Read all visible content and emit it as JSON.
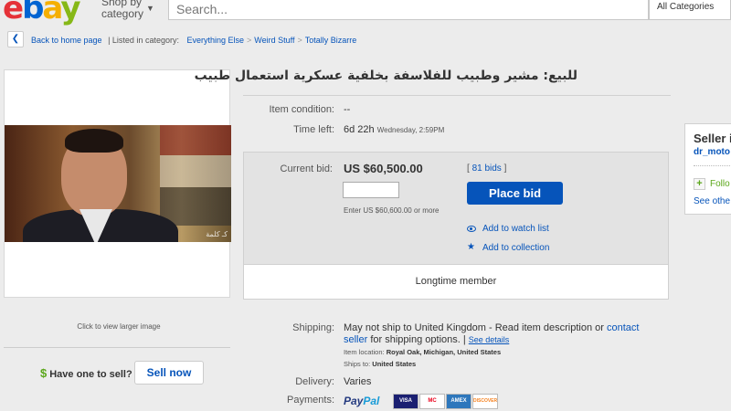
{
  "header": {
    "logo": {
      "e": "e",
      "b": "b",
      "a": "a",
      "y": "y"
    },
    "shop_by_category": "Shop by category",
    "search_placeholder": "Search...",
    "category_select": "All Categories"
  },
  "breadcrumb": {
    "back_label": "Back to home page",
    "listed_in": "| Listed in category:",
    "items": [
      "Everything Else",
      "Weird Stuff",
      "Totally Bizarre"
    ],
    "separator": ">"
  },
  "image_panel": {
    "watermark": "كـ كلمة",
    "view_larger": "Click to view larger image"
  },
  "sell": {
    "prompt": "Have one to sell?",
    "button": "Sell now"
  },
  "listing": {
    "title": "للبيع: مشير وطبيب للفلاسفة بخلفية عسكرية استعمال طبيب",
    "condition_label": "Item condition:",
    "condition_value": "--",
    "time_left_label": "Time left:",
    "time_left_value": "6d 22h",
    "time_left_date": "Wednesday, 2:59PM"
  },
  "bid": {
    "current_bid_label": "Current bid:",
    "current_bid_value": "US $60,500.00",
    "bids_count": "81 bids",
    "bids_prefix": "[",
    "bids_suffix": "]",
    "input_value": "",
    "enter_hint": "Enter US $60,600.00 or more",
    "place_bid": "Place bid",
    "watch_list": "Add to watch list",
    "collection": "Add to collection",
    "longtime_member": "Longtime member"
  },
  "seller": {
    "title": "Seller i",
    "name": "dr_moto",
    "follow": "Follo",
    "see_other": "See othe"
  },
  "shipping": {
    "label": "Shipping:",
    "text_1": "May not ship to United Kingdom - Read item description or ",
    "contact_seller": "contact seller",
    "text_2": " for shipping options. | ",
    "see_details": "See details",
    "location_label": "Item location:",
    "location_value": "Royal Oak, Michigan, United States",
    "ships_to_label": "Ships to:",
    "ships_to_value": "United States"
  },
  "delivery": {
    "label": "Delivery:",
    "value": "Varies"
  },
  "payments": {
    "label": "Payments:",
    "paypal_pay": "Pay",
    "paypal_pal": "Pal",
    "cards": [
      "VISA",
      "MC",
      "AMEX",
      "DISCOVER"
    ]
  },
  "colors": {
    "link": "#0654ba",
    "brand_red": "#e53238",
    "brand_blue": "#0064d2",
    "brand_yellow": "#f5af02",
    "brand_green": "#86b817"
  }
}
